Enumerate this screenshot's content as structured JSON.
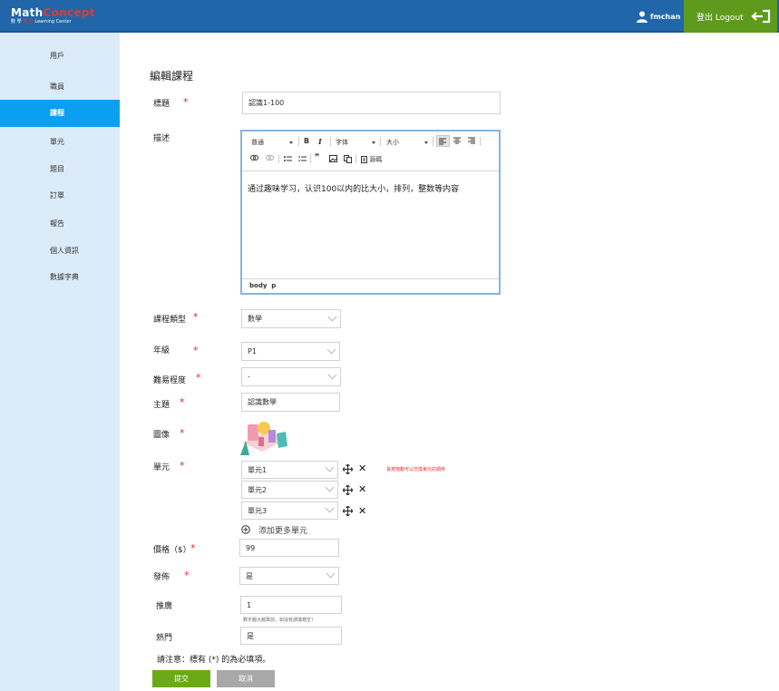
{
  "header": {
    "logo_main_white": "Math",
    "logo_main_red": "Concept",
    "logo_sub_white": "數 學",
    "logo_sub_red": "概 念",
    "logo_sub_tail": "Learning Center",
    "username": "fmchan",
    "logout_label": "登出 Logout",
    "accent_color": "#5e9a1c",
    "bar_color": "#2166a8"
  },
  "sidebar": {
    "items": [
      {
        "label": "用戶"
      },
      {
        "label": "職員"
      },
      {
        "label": "課程",
        "active": true
      },
      {
        "label": "單元"
      },
      {
        "label": "題目"
      },
      {
        "label": "訂單"
      },
      {
        "label": "報告"
      },
      {
        "label": "個人資訊"
      },
      {
        "label": "數據字典"
      }
    ],
    "active_color": "#0b9ff2"
  },
  "form": {
    "page_title": "編輯課程",
    "title": {
      "label": "標題",
      "value": "認識1-100"
    },
    "description": {
      "label": "描述",
      "toolbar": {
        "format": "普通",
        "font": "字体",
        "size": "大小",
        "source": "源碼"
      },
      "content": "通过趣味学习，认识100以内的比大小，排列，整数等内容",
      "status_path": [
        "body",
        "p"
      ]
    },
    "course_type": {
      "label": "課程類型",
      "value": "數學"
    },
    "grade": {
      "label": "年級",
      "value": "P1"
    },
    "difficulty": {
      "label": "難易程度",
      "value": "-"
    },
    "topic": {
      "label": "主題",
      "value": "認識數學"
    },
    "image": {
      "label": "圖像"
    },
    "units": {
      "label": "單元",
      "hint": "長按拖動可以交換單元的順序",
      "items": [
        "單元1",
        "單元2",
        "單元3"
      ],
      "add_more": "添加更多單元"
    },
    "price": {
      "label": "價格（$）",
      "value": "99"
    },
    "publish": {
      "label": "發佈",
      "value": "是"
    },
    "promotion": {
      "label": "推廣",
      "value": "1",
      "hint": "數字越大越靠前，如沒有請填寫空！"
    },
    "popular": {
      "label": "熱門",
      "value": "是"
    },
    "note": "請注意：標有 (*) 的為必填項。",
    "submit_label": "提交",
    "cancel_label": "取消",
    "required_mark": "*"
  }
}
